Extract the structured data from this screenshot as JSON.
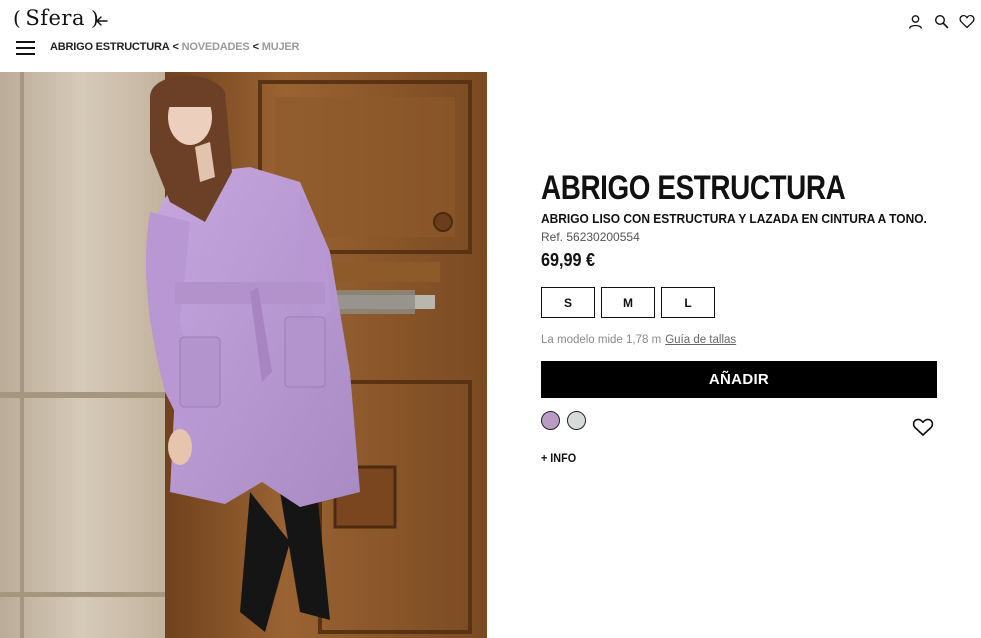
{
  "header": {
    "logo_text": "Sfera",
    "logo_left": "(",
    "logo_right": ")",
    "icons": [
      "back-arrow-icon",
      "menu-icon",
      "user-icon",
      "search-icon",
      "heart-icon"
    ]
  },
  "breadcrumb": {
    "current": "ABRIGO ESTRUCTURA",
    "separator": "<",
    "links": [
      "NOVEDADES",
      "MUJER"
    ]
  },
  "product": {
    "title": "ABRIGO ESTRUCTURA",
    "subtitle": "ABRIGO LISO CON ESTRUCTURA Y LAZADA EN CINTURA A TONO.",
    "ref": "Ref. 56230200554",
    "price": "69,99 €",
    "sizes": [
      "S",
      "M",
      "L"
    ],
    "model_info": "La modelo mide 1,78 m",
    "size_guide": "Guía de tallas",
    "add_button": "AÑADIR",
    "colors": [
      {
        "name": "lilac",
        "hex": "#b99bc4"
      },
      {
        "name": "light-grey",
        "hex": "#d6dadb"
      }
    ],
    "more_info": "+ INFO"
  },
  "colors": {
    "accent": "#000000",
    "breadcrumb_link": "#9a9a9a"
  }
}
